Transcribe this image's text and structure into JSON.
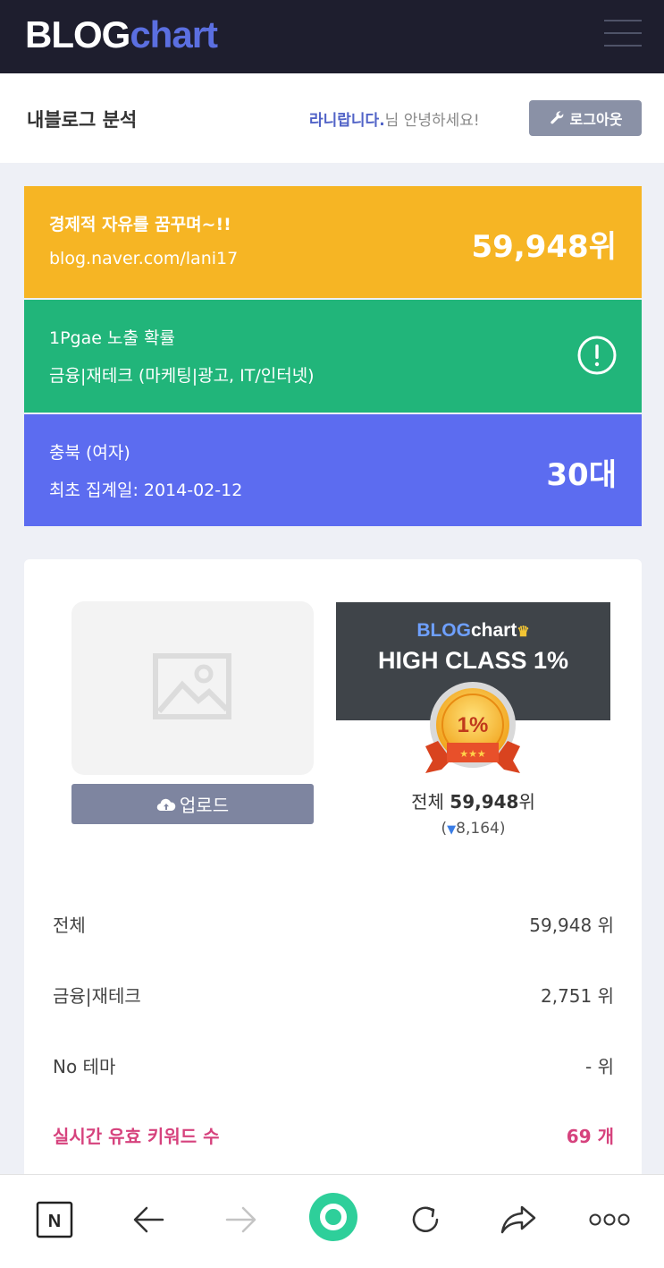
{
  "header": {
    "logo_part1": "BLOG",
    "logo_part2": "chart"
  },
  "subheader": {
    "title": "내블로그 분석",
    "user_name": "라니랍니다.",
    "greeting_suffix": "님 안녕하세요!",
    "logout_label": "로그아웃"
  },
  "cards": {
    "blog": {
      "name": "경제적 자유를 꿈꾸며~!!",
      "url": "blog.naver.com/lani17",
      "rank": "59,948위"
    },
    "exposure": {
      "title": "1Pgae 노출 확률",
      "category": "금융|재테크 (마케팅|광고, IT/인터넷)"
    },
    "demographic": {
      "region_gender": "충북 (여자)",
      "first_date": "최초 집계일: 2014-02-12",
      "age": "30대"
    }
  },
  "profile": {
    "upload_label": "업로드",
    "banner_logo_1": "BLOG",
    "banner_logo_2": "chart",
    "banner_title": "HIGH CLASS 1%",
    "medal_text": "1%",
    "rank_total_label": "전체",
    "rank_total_value": "59,948",
    "rank_total_unit": "위",
    "rank_change": "8,164"
  },
  "stats": [
    {
      "label": "전체",
      "value": "59,948 위"
    },
    {
      "label": "금융|재테크",
      "value": "2,751 위"
    },
    {
      "label": "No 테마",
      "value": "- 위"
    },
    {
      "label": "실시간 유효 키워드 수",
      "value": "69 개"
    }
  ],
  "bottom_nav": {
    "n_label": "N"
  },
  "colors": {
    "topbar": "#1e1e2e",
    "logo_accent": "#5b6fe0",
    "card_yellow": "#f6b524",
    "card_green": "#21b57a",
    "card_blue": "#5c6cf0",
    "keyword_pink": "#d6427d",
    "home_green": "#2ecf9a"
  },
  "icons": [
    "hamburger-icon",
    "wrench-icon",
    "exclamation-icon",
    "image-placeholder-icon",
    "cloud-upload-icon",
    "medal-icon",
    "down-triangle-icon",
    "naver-n-icon",
    "back-arrow-icon",
    "forward-arrow-icon",
    "home-circle-icon",
    "refresh-icon",
    "share-icon",
    "more-icon"
  ]
}
